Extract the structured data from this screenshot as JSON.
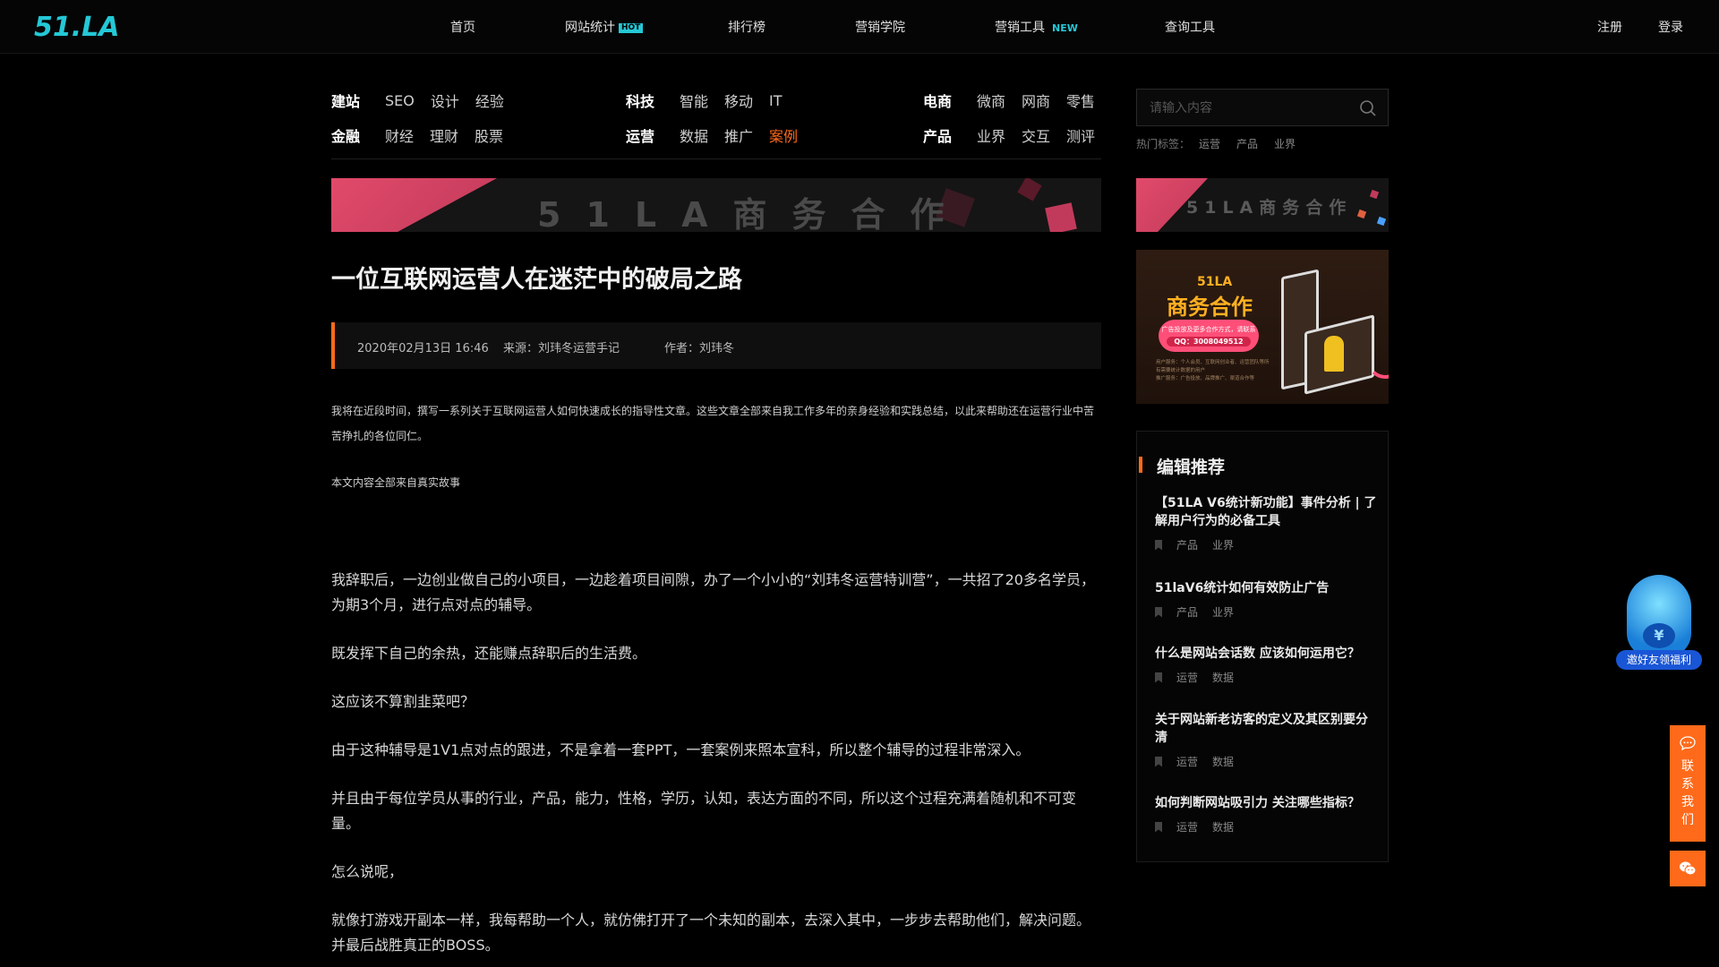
{
  "header": {
    "logo": "51.LA",
    "nav": [
      {
        "label": "首页"
      },
      {
        "label": "网站统计",
        "badge": "HOT"
      },
      {
        "label": "排行榜"
      },
      {
        "label": "营销学院"
      },
      {
        "label": "营销工具",
        "badge": "NEW"
      },
      {
        "label": "查询工具"
      }
    ],
    "register": "注册",
    "login": "登录"
  },
  "categories": {
    "row1": [
      {
        "head": "建站",
        "subs": [
          "SEO",
          "设计",
          "经验"
        ]
      },
      {
        "head": "科技",
        "subs": [
          "智能",
          "移动",
          "IT"
        ]
      },
      {
        "head": "电商",
        "subs": [
          "微商",
          "网商",
          "零售"
        ]
      }
    ],
    "row2": [
      {
        "head": "金融",
        "subs": [
          "财经",
          "理财",
          "股票"
        ]
      },
      {
        "head": "运营",
        "subs": [
          "数据",
          "推广",
          "案例"
        ]
      },
      {
        "head": "产品",
        "subs": [
          "业界",
          "交互",
          "测评"
        ]
      }
    ],
    "active": "案例"
  },
  "banner": {
    "text": "51LA商务合作"
  },
  "article": {
    "title": "一位互联网运营人在迷茫中的破局之路",
    "date": "2020年02月13日 16:46",
    "source": "来源：刘玮冬运营手记",
    "author": "作者：刘玮冬",
    "intro": "我将在近段时间，撰写一系列关于互联网运营人如何快速成长的指导性文章。这些文章全部来自我工作多年的亲身经验和实践总结，以此来帮助还在运营行业中苦苦挣扎的各位同仁。",
    "intro2": "本文内容全部来自真实故事",
    "paragraphs": [
      "我辞职后，一边创业做自己的小项目，一边趁着项目间隙，办了一个小小的“刘玮冬运营特训营”，一共招了20多名学员，为期3个月，进行点对点的辅导。",
      "既发挥下自己的余热，还能赚点辞职后的生活费。",
      "这应该不算割韭菜吧？",
      "由于这种辅导是1V1点对点的跟进，不是拿着一套PPT，一套案例来照本宣科，所以整个辅导的过程非常深入。",
      "并且由于每位学员从事的行业，产品，能力，性格，学历，认知，表达方面的不同，所以这个过程充满着随机和不可变量。",
      "怎么说呢，",
      "就像打游戏开副本一样，我每帮助一个人，就仿佛打开了一个未知的副本，去深入其中，一步步去帮助他们，解决问题。并最后战胜真正的BOSS。"
    ]
  },
  "sidebar": {
    "search_placeholder": "请输入内容",
    "hot_label": "热门标签：",
    "hot_tags": [
      "运营",
      "产品",
      "业界"
    ],
    "banner1_text": "51LA商务合作",
    "banner2": {
      "line1": "51LA",
      "line2": "商务合作",
      "pill_text": "广告投放及更多合作方式，请联系",
      "qq": "QQ：3008049512",
      "small1": "用户服务：个人会员、互联网创业者、运营团队等所有需要统计数据的用户",
      "small2": "推广服务：广告投放、品牌推广、渠道合作等"
    },
    "rec_title": "编辑推荐",
    "rec_items": [
      {
        "title": "【51LA V6统计新功能】事件分析 | 了解用户行为的必备工具",
        "tags": [
          "产品",
          "业界"
        ]
      },
      {
        "title": "51laV6统计如何有效防止广告",
        "tags": [
          "产品",
          "业界"
        ]
      },
      {
        "title": "什么是网站会话数 应该如何运用它？",
        "tags": [
          "运营",
          "数据"
        ]
      },
      {
        "title": "关于网站新老访客的定义及其区别要分清",
        "tags": [
          "运营",
          "数据"
        ]
      },
      {
        "title": "如何判断网站吸引力 关注哪些指标？",
        "tags": [
          "运营",
          "数据"
        ]
      }
    ]
  },
  "floating": {
    "invite_label": "邀好友领福利",
    "coin_symbol": "¥",
    "contact": [
      "联",
      "系",
      "我",
      "们"
    ]
  }
}
